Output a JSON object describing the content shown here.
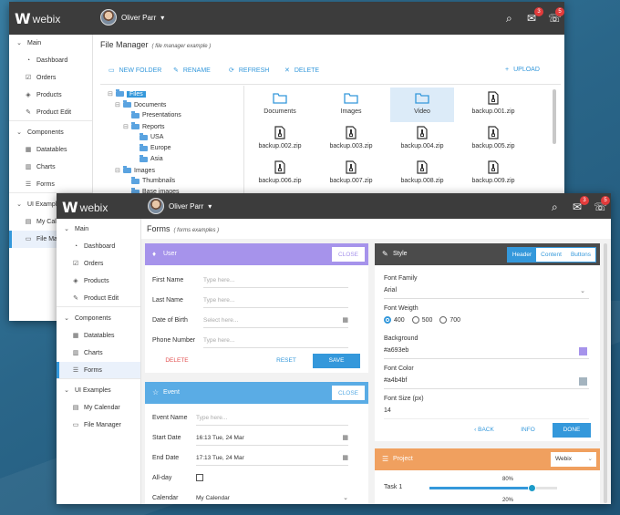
{
  "back": {
    "brand": "webix",
    "user": "Oliver Parr",
    "mail_badge": "3",
    "chat_badge": "5",
    "sidebar": [
      {
        "label": "Main",
        "icon": "chevron-down-icon",
        "group": true
      },
      {
        "label": "Dashboard",
        "icon": "dashboard-icon"
      },
      {
        "label": "Orders",
        "icon": "check-square-icon"
      },
      {
        "label": "Products",
        "icon": "cube-icon"
      },
      {
        "label": "Product Edit",
        "icon": "edit-icon"
      },
      {
        "label": "Components",
        "icon": "chevron-down-icon",
        "group": true
      },
      {
        "label": "Datatables",
        "icon": "table-icon"
      },
      {
        "label": "Charts",
        "icon": "bar-chart-icon"
      },
      {
        "label": "Forms",
        "icon": "forms-icon"
      },
      {
        "label": "UI Examples",
        "icon": "chevron-down-icon",
        "group": true
      },
      {
        "label": "My Calendar",
        "icon": "calendar-icon"
      },
      {
        "label": "File Manager",
        "icon": "folder-icon"
      }
    ],
    "title": "File Manager",
    "subtitle": "( file manager example )",
    "toolbar": {
      "new_folder": "NEW FOLDER",
      "rename": "RENAME",
      "refresh": "REFRESH",
      "delete": "DELETE",
      "upload": "UPLOAD"
    },
    "tree": [
      "Files",
      "Documents",
      "Presentations",
      "Reports",
      "USA",
      "Europe",
      "Asia",
      "Images",
      "Thumbnails",
      "Base images"
    ],
    "files": [
      {
        "name": "Documents",
        "type": "folder"
      },
      {
        "name": "Images",
        "type": "folder"
      },
      {
        "name": "Video",
        "type": "folder"
      },
      {
        "name": "backup.001.zip",
        "type": "zip"
      },
      {
        "name": "backup.002.zip",
        "type": "zip"
      },
      {
        "name": "backup.003.zip",
        "type": "zip"
      },
      {
        "name": "backup.004.zip",
        "type": "zip"
      },
      {
        "name": "backup.005.zip",
        "type": "zip"
      },
      {
        "name": "backup.006.zip",
        "type": "zip"
      },
      {
        "name": "backup.007.zip",
        "type": "zip"
      },
      {
        "name": "backup.008.zip",
        "type": "zip"
      },
      {
        "name": "backup.009.zip",
        "type": "zip"
      }
    ]
  },
  "front": {
    "brand": "webix",
    "user": "Oliver Parr",
    "mail_badge": "3",
    "chat_badge": "5",
    "sidebar": [
      {
        "label": "Main",
        "group": true
      },
      {
        "label": "Dashboard"
      },
      {
        "label": "Orders"
      },
      {
        "label": "Products"
      },
      {
        "label": "Product Edit"
      },
      {
        "label": "Components",
        "group": true
      },
      {
        "label": "Datatables"
      },
      {
        "label": "Charts"
      },
      {
        "label": "Forms"
      },
      {
        "label": "UI Examples",
        "group": true
      },
      {
        "label": "My Calendar"
      },
      {
        "label": "File Manager"
      }
    ],
    "title": "Forms",
    "subtitle": "( forms examples )",
    "user_panel": {
      "title": "User",
      "close": "CLOSE",
      "first_name": "First Name",
      "last_name": "Last Name",
      "dob": "Date of Birth",
      "phone": "Phone Number",
      "placeholder": "Type here...",
      "dob_placeholder": "Select here...",
      "delete": "DELETE",
      "reset": "RESET",
      "save": "SAVE"
    },
    "style_panel": {
      "title": "Style",
      "tabs": [
        "Header",
        "Content",
        "Buttons"
      ],
      "font_family_label": "Font Family",
      "font_family": "Arial",
      "font_weight_label": "Font Weigth",
      "weights": [
        "400",
        "500",
        "700"
      ],
      "background_label": "Background",
      "background": "#a693eb",
      "font_color_label": "Font Color",
      "font_color": "#a4b4bf",
      "font_size_label": "Font Size (px)",
      "font_size": "14",
      "back": "BACK",
      "info": "INFO",
      "done": "DONE"
    },
    "event_panel": {
      "title": "Event",
      "close": "CLOSE",
      "event_name": "Event Name",
      "placeholder": "Type here...",
      "start_date": "Start Date",
      "start_value": "16:13 Tue, 24 Mar",
      "end_date": "End Date",
      "end_value": "17:13 Tue, 24 Mar",
      "all_day": "All-day",
      "calendar": "Calendar",
      "calendar_value": "My Calendar"
    },
    "project_panel": {
      "title": "Project",
      "select": "Webix",
      "task1": "Task 1",
      "task1_pct": "80%",
      "task1_value": 0.8,
      "task2_pct": "20%",
      "task2_value": 0.2
    },
    "colors": {
      "user_head": "#a693eb",
      "event_head": "#5aace5",
      "style_head": "#4b4b4b",
      "project_head": "#f0a05f",
      "accent": "#3498db",
      "delete": "#e25050"
    }
  }
}
